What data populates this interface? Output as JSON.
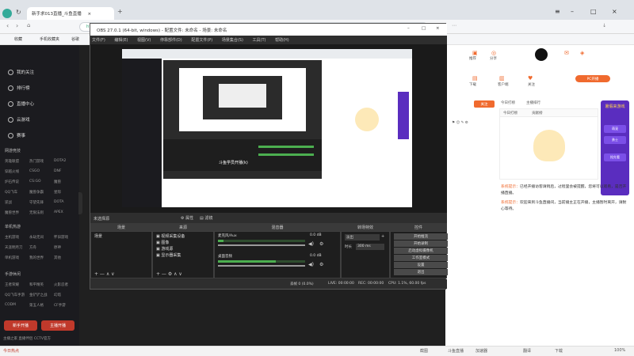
{
  "browser": {
    "tab_title": "新手求013直播_斗鱼直播",
    "address": "https://",
    "bookmarks": [
      "收藏",
      "手机收藏夹",
      "谷歌"
    ]
  },
  "sidebar": {
    "main": [
      "我的关注",
      "排行榜",
      "直播中心",
      "云游戏",
      "赛事"
    ],
    "sec1_title": "网游竞技",
    "sec1_games": [
      "英雄联盟",
      "热门游戏",
      "DOTA2",
      "穿越火线",
      "CSGO",
      "DNF",
      "炉石传说",
      "CS:GO",
      "魔兽",
      "QQ飞车",
      "魔兽争霸",
      "星际",
      "逆战",
      "守望先锋",
      "DOTA",
      "魔兽世界",
      "无限法则",
      "APEX"
    ],
    "sec2_title": "单机热游",
    "sec2_games": [
      "主机游戏",
      "永劫无间",
      "怀旧游戏",
      "天涯明月刀",
      "方舟",
      "原神",
      "单机游戏",
      "我的世界",
      "其他"
    ],
    "sec3_title": "手游休闲",
    "sec3_games": [
      "王者荣耀",
      "和平精英",
      "火影忍者",
      "QQ飞车手游",
      "金铲铲之战",
      "幻塔",
      "CODM",
      "第五人格",
      "CF手游"
    ],
    "btn_open": "新手开播",
    "btn_download": "主播开播",
    "footer": "主播之家    直播伴侣    CCTV官方"
  },
  "obs": {
    "title": "OBS 27.0.1 (64-bit, windows) - 配置文件: 未命名 - 场景: 未命名",
    "menu": [
      "文件(F)",
      "编辑(E)",
      "视图(V)",
      "停靠部件(D)",
      "配置文件(P)",
      "场景集合(S)",
      "工具(T)",
      "帮助(H)"
    ],
    "preview_title": "斗鱼学员开播(k)",
    "no_source": "未选择源",
    "toolbar_props": "属性",
    "toolbar_filters": "滤镜",
    "docks": {
      "scenes": "场景",
      "sources": "来源",
      "mixer": "混音器",
      "transitions": "转场特效",
      "controls": "控件"
    },
    "scene_items": [
      "场景"
    ],
    "source_items": [
      "视频采集设备",
      "图像",
      "游戏源",
      "显示器采集"
    ],
    "mixer_tracks": [
      {
        "name": "麦克风/Aux",
        "db": "0.0 dB",
        "level": 0.06
      },
      {
        "name": "桌面音频",
        "db": "0.0 dB",
        "level": 0.66
      }
    ],
    "transition_type": "淡出",
    "duration_label": "时长",
    "duration_value": "300 ms",
    "controls": [
      "开始推流",
      "开始录制",
      "启动虚拟摄像机",
      "工作室模式",
      "设置",
      "退出"
    ],
    "status": {
      "drop": "丢帧 0 (0.0%)",
      "live": "LIVE: 00:00:00",
      "rec": "REC: 00:00:00",
      "cpu": "CPU: 1.1%, 60.00 fps"
    }
  },
  "right_panel": {
    "icons": [
      "推荐",
      "分享",
      "下载",
      "客户端",
      "关注",
      "反馈"
    ],
    "follow_btn": "关注",
    "live_btn": "PC开播",
    "tabs": [
      "今日打榜",
      "主播排行",
      "贡献榜"
    ],
    "promo_title": "暑假来游戏",
    "promo_btns": [
      "萌宠",
      "勇士",
      "抢先看"
    ],
    "msg1_tag": "系统提示：",
    "msg1": "已经开播访客请稍后，过程里会被提醒，您将可以观看，是否开播直播。",
    "msg2_tag": "系统提示：",
    "msg2": "欢迎来到斗鱼直播间，当前播主正在开播，主播暂时离开，请耐心等待。"
  },
  "taskbar": {
    "left": "今日热点",
    "items": [
      "截图",
      "斗鱼直播",
      "加速器",
      "翻译",
      "下载",
      "100%"
    ]
  },
  "colors": {
    "accent": "#f06a2e",
    "obs_bg": "#2b2b2b",
    "meter_green": "#4caf50",
    "purple": "#6c3fd1"
  }
}
